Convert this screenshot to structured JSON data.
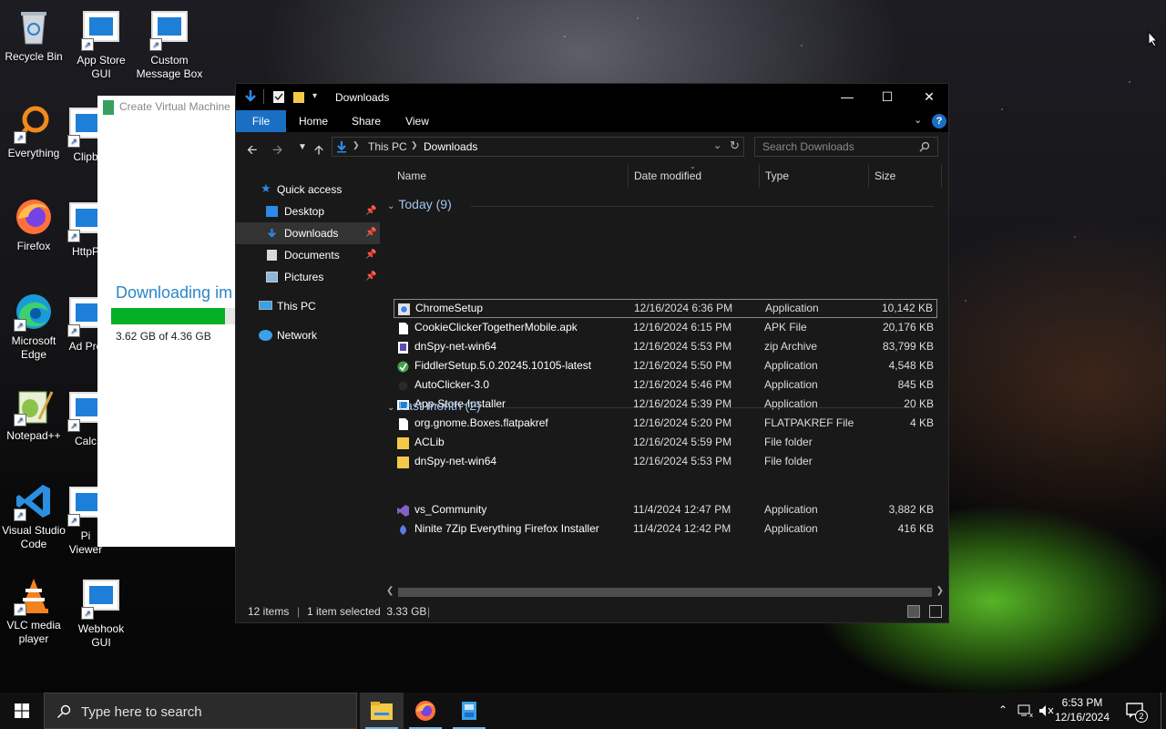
{
  "desktop": {
    "icons": [
      {
        "label": "Recycle Bin",
        "icon": "recycle-bin-icon"
      },
      {
        "label": "App Store GUI",
        "icon": "app-window-icon"
      },
      {
        "label": "Custom Message Box",
        "icon": "app-window-icon"
      },
      {
        "label": "Everything",
        "icon": "magnifier-icon"
      },
      {
        "label": "Clipb",
        "icon": "app-window-icon"
      },
      {
        "label": "Firefox",
        "icon": "firefox-icon"
      },
      {
        "label": "HttpP",
        "icon": "app-window-icon"
      },
      {
        "label": "Microsoft Edge",
        "icon": "edge-icon"
      },
      {
        "label": "Ad Pro",
        "icon": "app-window-icon"
      },
      {
        "label": "Notepad++",
        "icon": "notepadpp-icon"
      },
      {
        "label": "Calc",
        "icon": "app-window-icon"
      },
      {
        "label": "Visual Studio Code",
        "icon": "vscode-icon"
      },
      {
        "label": "Pi Viewer",
        "icon": "app-window-icon"
      },
      {
        "label": "VLC media player",
        "icon": "vlc-icon"
      },
      {
        "label": "Webhook GUI",
        "icon": "app-window-icon"
      }
    ]
  },
  "vm_window": {
    "title": "Create Virtual Machine",
    "heading": "Downloading im",
    "progress_fraction": 0.83,
    "size_text": "3.62 GB of 4.36 GB"
  },
  "explorer": {
    "title": "Downloads",
    "ribbon_tabs": [
      "File",
      "Home",
      "Share",
      "View"
    ],
    "breadcrumb": [
      "This PC",
      "Downloads"
    ],
    "search_placeholder": "Search Downloads",
    "nav": {
      "quick_access": "Quick access",
      "pinned": [
        "Desktop",
        "Downloads",
        "Documents",
        "Pictures"
      ],
      "this_pc": "This PC",
      "network": "Network"
    },
    "columns": [
      "Name",
      "Date modified",
      "Type",
      "Size"
    ],
    "groups": [
      {
        "label": "Today (9)",
        "files": [
          {
            "name": "ChromeSetup",
            "date": "12/16/2024 6:36 PM",
            "type": "Application",
            "size": "10,142 KB",
            "icon": "chrome-setup-icon",
            "selected": true
          },
          {
            "name": "CookieClickerTogetherMobile.apk",
            "date": "12/16/2024 6:15 PM",
            "type": "APK File",
            "size": "20,176 KB",
            "icon": "file-icon"
          },
          {
            "name": "dnSpy-net-win64",
            "date": "12/16/2024 5:53 PM",
            "type": "zip Archive",
            "size": "83,799 KB",
            "icon": "zip-icon"
          },
          {
            "name": "FiddlerSetup.5.0.20245.10105-latest",
            "date": "12/16/2024 5:50 PM",
            "type": "Application",
            "size": "4,548 KB",
            "icon": "fiddler-icon"
          },
          {
            "name": "AutoClicker-3.0",
            "date": "12/16/2024 5:46 PM",
            "type": "Application",
            "size": "845 KB",
            "icon": "autoclicker-icon"
          },
          {
            "name": "App-Store-Installer",
            "date": "12/16/2024 5:39 PM",
            "type": "Application",
            "size": "20 KB",
            "icon": "app-window-icon"
          },
          {
            "name": "org.gnome.Boxes.flatpakref",
            "date": "12/16/2024 5:20 PM",
            "type": "FLATPAKREF File",
            "size": "4 KB",
            "icon": "file-icon"
          },
          {
            "name": "ACLib",
            "date": "12/16/2024 5:59 PM",
            "type": "File folder",
            "size": "",
            "icon": "folder-icon"
          },
          {
            "name": "dnSpy-net-win64",
            "date": "12/16/2024 5:53 PM",
            "type": "File folder",
            "size": "",
            "icon": "folder-icon"
          }
        ]
      },
      {
        "label": "Last month (2)",
        "files": [
          {
            "name": "vs_Community",
            "date": "11/4/2024 12:47 PM",
            "type": "Application",
            "size": "3,882 KB",
            "icon": "visual-studio-icon"
          },
          {
            "name": "Ninite 7Zip Everything Firefox Installer",
            "date": "11/4/2024 12:42 PM",
            "type": "Application",
            "size": "416 KB",
            "icon": "ninite-icon"
          }
        ]
      }
    ],
    "status": {
      "item_count": "12 items",
      "selection": "1 item selected  3.33 GB"
    }
  },
  "taskbar": {
    "search_placeholder": "Type here to search",
    "apps": [
      "file-explorer-icon",
      "firefox-icon",
      "vm-app-icon"
    ],
    "time": "6:53 PM",
    "date": "12/16/2024",
    "notification_count": "2"
  },
  "colors": {
    "accent": "#1a6fc4",
    "group_text": "#9dc4ef",
    "progress": "#06b025",
    "link_blue": "#2a86c8"
  }
}
